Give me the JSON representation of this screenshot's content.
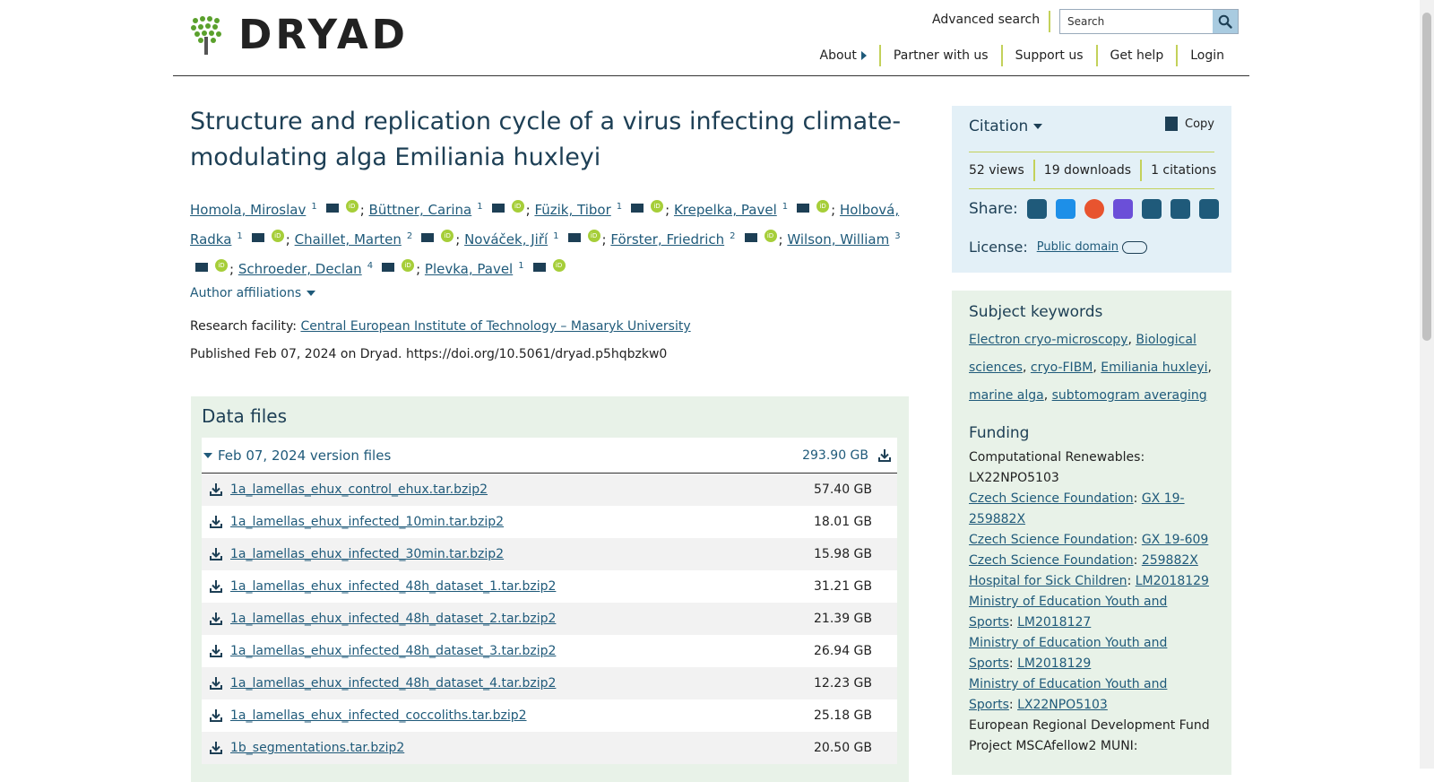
{
  "header": {
    "logo_text": "DRYAD",
    "advanced_search": "Advanced search",
    "search_placeholder": "Search",
    "nav": [
      "About",
      "Partner with us",
      "Support us",
      "Get help",
      "Login"
    ]
  },
  "dataset": {
    "title": "Structure and replication cycle of a virus infecting climate-modulating alga Emiliania huxleyi",
    "authors": [
      {
        "name": "Homola, Miroslav",
        "aff": "1"
      },
      {
        "name": "Büttner, Carina",
        "aff": "1"
      },
      {
        "name": "Füzik, Tibor",
        "aff": "1"
      },
      {
        "name": "Krepelka, Pavel",
        "aff": "1"
      },
      {
        "name": "Holbová, Radka",
        "aff": "1"
      },
      {
        "name": "Chaillet, Marten",
        "aff": "2"
      },
      {
        "name": "Nováček, Jiří",
        "aff": "1"
      },
      {
        "name": "Förster, Friedrich",
        "aff": "2"
      },
      {
        "name": "Wilson, William",
        "aff": "3"
      },
      {
        "name": "Schroeder, Declan",
        "aff": "4"
      },
      {
        "name": "Plevka, Pavel",
        "aff": "1"
      }
    ],
    "author_affiliations_label": "Author affiliations",
    "facility_label": "Research facility:",
    "facility_name": "Central European Institute of Technology – Masaryk University",
    "published": "Published Feb 07, 2024 on Dryad. https://doi.org/10.5061/dryad.p5hqbzkw0"
  },
  "data_files": {
    "heading": "Data files",
    "version_label": "Feb 07, 2024 version files",
    "version_size": "293.90 GB",
    "files": [
      {
        "name": "1a_lamellas_ehux_control_ehux.tar.bzip2",
        "size": "57.40 GB"
      },
      {
        "name": "1a_lamellas_ehux_infected_10min.tar.bzip2",
        "size": "18.01 GB"
      },
      {
        "name": "1a_lamellas_ehux_infected_30min.tar.bzip2",
        "size": "15.98 GB"
      },
      {
        "name": "1a_lamellas_ehux_infected_48h_dataset_1.tar.bzip2",
        "size": "31.21 GB"
      },
      {
        "name": "1a_lamellas_ehux_infected_48h_dataset_2.tar.bzip2",
        "size": "21.39 GB"
      },
      {
        "name": "1a_lamellas_ehux_infected_48h_dataset_3.tar.bzip2",
        "size": "26.94 GB"
      },
      {
        "name": "1a_lamellas_ehux_infected_48h_dataset_4.tar.bzip2",
        "size": "12.23 GB"
      },
      {
        "name": "1a_lamellas_ehux_infected_coccoliths.tar.bzip2",
        "size": "25.18 GB"
      },
      {
        "name": "1b_segmentations.tar.bzip2",
        "size": "20.50 GB"
      }
    ]
  },
  "citation": {
    "label": "Citation",
    "copy": "Copy",
    "views": "52 views",
    "downloads": "19 downloads",
    "citations": "1 citations",
    "share_label": "Share:",
    "share_icons": [
      "linkedin-icon",
      "bluesky-icon",
      "reddit-icon",
      "mastodon-icon",
      "facebook-icon",
      "email-icon",
      "share-icon"
    ],
    "license_label": "License:",
    "license_value": "Public domain"
  },
  "keywords": {
    "heading": "Subject keywords",
    "items": [
      "Electron cryo-microscopy",
      "Biological sciences",
      "cryo-FIBM",
      "Emiliania huxleyi",
      "marine alga",
      "subtomogram averaging"
    ]
  },
  "funding": {
    "heading": "Funding",
    "items": [
      {
        "funder": "Computational Renewables:",
        "grant": "LX22NPO5103",
        "linked": false
      },
      {
        "funder": "Czech Science Foundation",
        "grant": "GX 19-259882X",
        "linked": true
      },
      {
        "funder": "Czech Science Foundation",
        "grant": "GX 19-609",
        "linked": true
      },
      {
        "funder": "Czech Science Foundation",
        "grant": "259882X",
        "linked": true
      },
      {
        "funder": "Hospital for Sick Children",
        "grant": "LM2018129",
        "linked": true
      },
      {
        "funder": "Ministry of Education Youth and Sports",
        "grant": "LM2018127",
        "linked": true
      },
      {
        "funder": "Ministry of Education Youth and Sports",
        "grant": "LM2018129",
        "linked": true
      },
      {
        "funder": "Ministry of Education Youth and Sports",
        "grant": "LX22NPO5103",
        "linked": true
      },
      {
        "funder": "European Regional Development Fund Project MSCAfellow2 MUNI:",
        "grant": "",
        "linked": false
      }
    ]
  },
  "colors": {
    "accent": "#1f5a7a",
    "divider": "#c3d15a",
    "citation_bg": "#e3f0f7",
    "panel_bg": "#e8f2e8",
    "orcid": "#a6ce39"
  }
}
